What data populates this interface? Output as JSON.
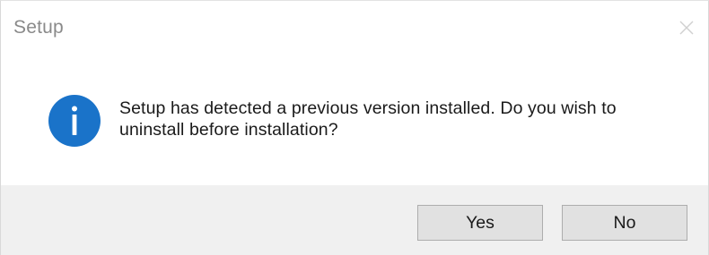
{
  "window": {
    "title": "Setup"
  },
  "dialog": {
    "message": "Setup has detected a previous version installed. Do you wish to uninstall before installation?",
    "icon": "info-icon",
    "icon_color": "#1a73c9"
  },
  "buttons": {
    "yes_label": "Yes",
    "no_label": "No"
  }
}
